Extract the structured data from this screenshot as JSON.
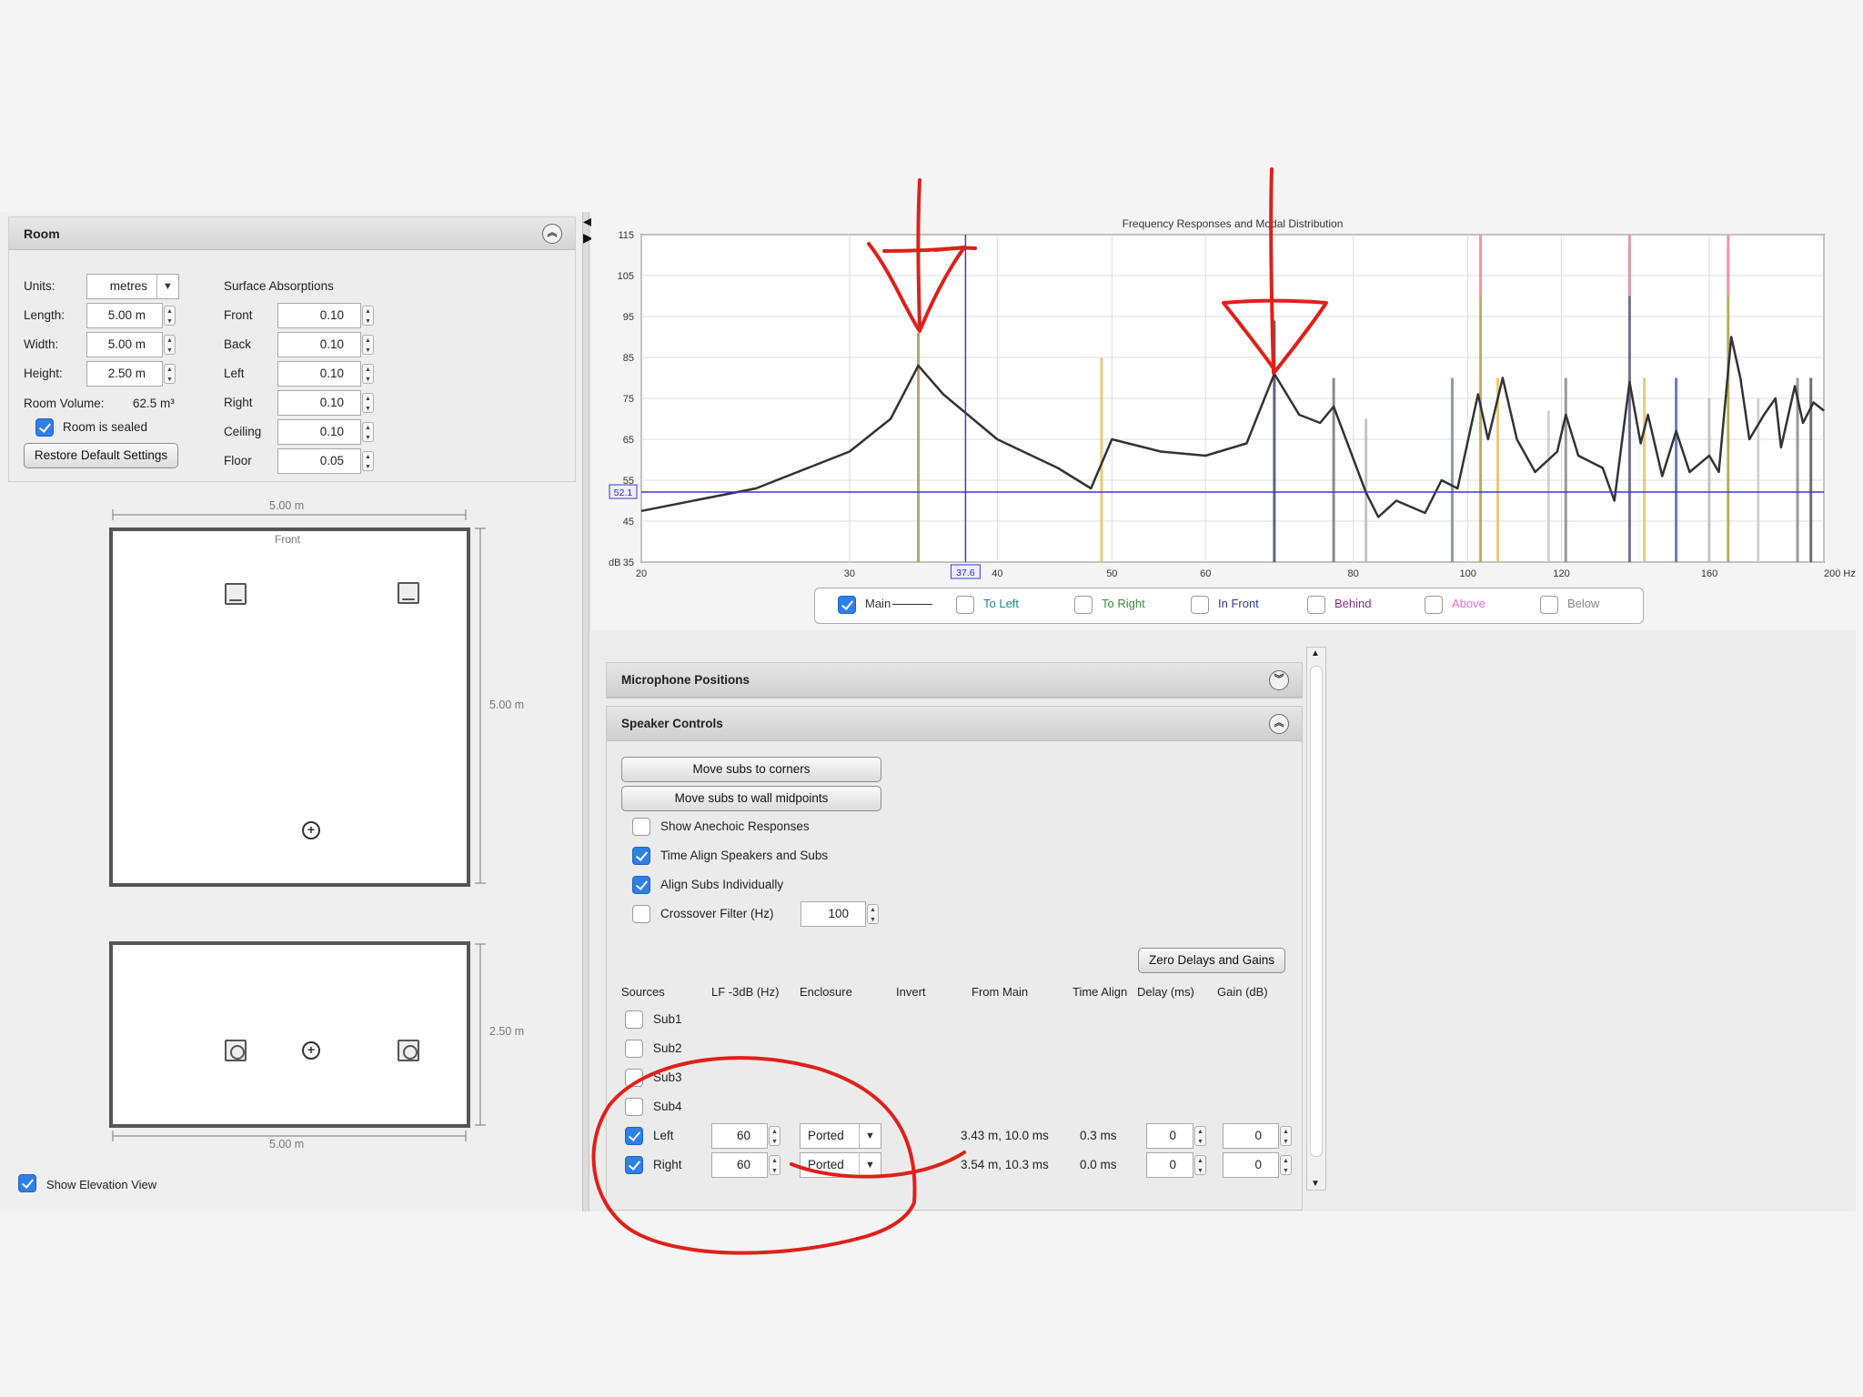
{
  "room": {
    "title": "Room",
    "units_label": "Units:",
    "units_value": "metres",
    "length_label": "Length:",
    "length_value": "5.00 m",
    "width_label": "Width:",
    "width_value": "5.00 m",
    "height_label": "Height:",
    "height_value": "2.50 m",
    "volume_label": "Room Volume:",
    "volume_value": "62.5 m³",
    "sealed_label": "Room is sealed",
    "restore_label": "Restore Default Settings",
    "surface_title": "Surface Absorptions",
    "surfaces": [
      {
        "label": "Front",
        "value": "0.10"
      },
      {
        "label": "Back",
        "value": "0.10"
      },
      {
        "label": "Left",
        "value": "0.10"
      },
      {
        "label": "Right",
        "value": "0.10"
      },
      {
        "label": "Ceiling",
        "value": "0.10"
      },
      {
        "label": "Floor",
        "value": "0.05"
      }
    ]
  },
  "plan": {
    "top_width": "5.00 m",
    "front_label": "Front",
    "side_length": "5.00 m",
    "elev_height": "2.50 m",
    "elev_width": "5.00 m",
    "show_elevation_label": "Show Elevation View"
  },
  "graph": {
    "title": "Frequency Responses and Modal Distribution",
    "y_unit": "dB",
    "y_ticks": [
      "115",
      "105",
      "95",
      "85",
      "75",
      "65",
      "55",
      "45",
      "35"
    ],
    "x_ticks": [
      "20",
      "30",
      "40",
      "50",
      "60",
      "80",
      "100",
      "120",
      "160",
      "200 Hz"
    ],
    "cursor_y": "52.1",
    "cursor_x": "37.6"
  },
  "legend": [
    {
      "label": "Main",
      "color": "#333333",
      "checked": true
    },
    {
      "label": "To Left",
      "color": "#1a8a8a",
      "checked": false
    },
    {
      "label": "To Right",
      "color": "#3a8a3a",
      "checked": false
    },
    {
      "label": "In Front",
      "color": "#2a3a9a",
      "checked": false
    },
    {
      "label": "Behind",
      "color": "#8a2a8a",
      "checked": false
    },
    {
      "label": "Above",
      "color": "#e070e0",
      "checked": false
    },
    {
      "label": "Below",
      "color": "#888888",
      "checked": false
    }
  ],
  "panels": {
    "mic_title": "Microphone Positions",
    "spk_title": "Speaker Controls"
  },
  "speaker": {
    "move_corners": "Move subs to corners",
    "move_midpoints": "Move subs to wall midpoints",
    "anechoic": "Show Anechoic Responses",
    "time_align": "Time Align Speakers and Subs",
    "align_individually": "Align Subs Individually",
    "crossover": "Crossover Filter (Hz)",
    "crossover_value": "100",
    "zero_btn": "Zero Delays and Gains",
    "headers": [
      "Sources",
      "LF -3dB (Hz)",
      "Enclosure",
      "Invert",
      "From Main",
      "Time Align",
      "Delay (ms)",
      "Gain (dB)"
    ],
    "subs": [
      "Sub1",
      "Sub2",
      "Sub3",
      "Sub4"
    ],
    "rows": [
      {
        "name": "Left",
        "lf": "60",
        "enclosure": "Ported",
        "from_main": "3.43 m, 10.0 ms",
        "time_align": "0.3 ms",
        "delay": "0",
        "gain": "0"
      },
      {
        "name": "Right",
        "lf": "60",
        "enclosure": "Ported",
        "from_main": "3.54 m, 10.3 ms",
        "time_align": "0.0 ms",
        "delay": "0",
        "gain": "0"
      }
    ]
  }
}
